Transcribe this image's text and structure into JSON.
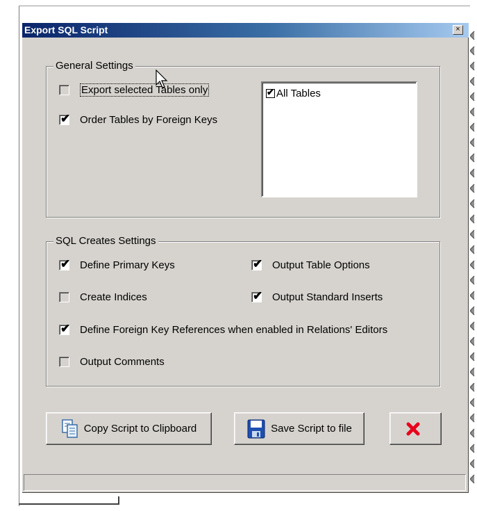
{
  "window": {
    "title": "Export SQL Script",
    "close_glyph": "×"
  },
  "general": {
    "legend": "General Settings",
    "export_selected": {
      "label": "Export selected Tables only",
      "checked": false
    },
    "order_by_fk": {
      "label": "Order Tables by Foreign Keys",
      "checked": true
    },
    "tables_list": [
      {
        "label": "All Tables",
        "checked": true
      }
    ]
  },
  "creates": {
    "legend": "SQL Creates Settings",
    "define_pk": {
      "label": "Define Primary Keys",
      "checked": true
    },
    "output_table_options": {
      "label": "Output Table Options",
      "checked": true
    },
    "create_indices": {
      "label": "Create Indices",
      "checked": false
    },
    "output_inserts": {
      "label": "Output Standard Inserts",
      "checked": true
    },
    "define_fk": {
      "label": "Define Foreign Key References when enabled in Relations' Editors",
      "checked": true
    },
    "output_comments": {
      "label": "Output Comments",
      "checked": false
    }
  },
  "buttons": {
    "copy": {
      "label": "Copy Script to Clipboard",
      "icon": "clipboard-copy-icon"
    },
    "save": {
      "label": "Save Script to file",
      "icon": "floppy-disk-icon"
    },
    "cancel": {
      "icon": "red-x-icon",
      "color": "#e8001c"
    }
  },
  "check_glyph": "✔",
  "colors": {
    "face": "#d6d3ce",
    "title_start": "#0a246a",
    "title_end": "#a6caf0"
  }
}
